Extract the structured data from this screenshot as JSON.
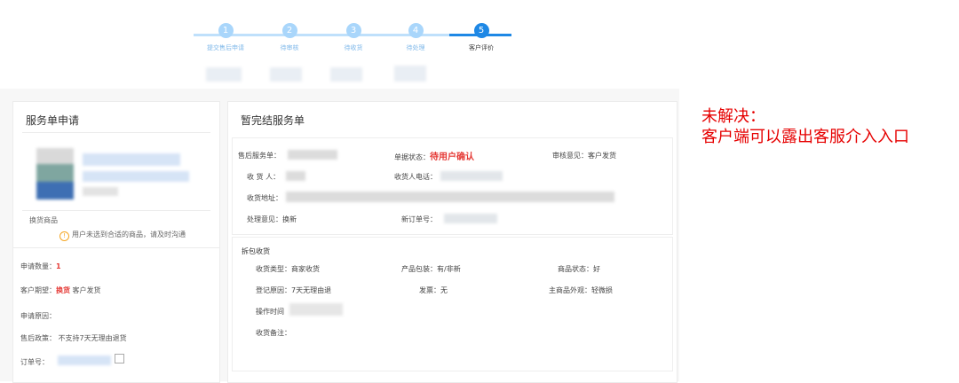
{
  "steps": [
    {
      "num": "1",
      "label": "提交售后申请"
    },
    {
      "num": "2",
      "label": "待审核"
    },
    {
      "num": "3",
      "label": "待收货"
    },
    {
      "num": "4",
      "label": "待处理"
    },
    {
      "num": "5",
      "label": "客户评价"
    }
  ],
  "left": {
    "title": "服务单申请",
    "swap_label": "换货商品",
    "warning": "用户未选到合适的商品，请及时沟通",
    "qty_label": "申请数量：",
    "qty_value": "1",
    "expect_label": "客户期望：",
    "expect_value": "换货",
    "expect_extra": "客户发货",
    "reason_label": "申请原因：",
    "policy_label": "售后政策：",
    "policy_value": "不支持7天无理由退货",
    "order_label": "订单号："
  },
  "right": {
    "title": "暂完结服务单",
    "service_no_label": "售后服务单：",
    "status_label": "单据状态：",
    "status_value": "待用户确认",
    "audit_label": "审核意见：",
    "audit_value": "客户发货",
    "receiver_label": "收 货 人：",
    "phone_label": "收货人电话：",
    "address_label": "收货地址：",
    "handle_label": "处理意见：",
    "handle_value": "换新",
    "new_order_label": "新订单号：",
    "unpack_title": "拆包收货",
    "recv_type_label": "收货类型：",
    "recv_type_value": "商家收货",
    "package_label": "产品包装：",
    "package_value": "有/非新",
    "goods_state_label": "商品状态：",
    "goods_state_value": "好",
    "reg_reason_label": "登记原因：",
    "reg_reason_value": "7天无理由退",
    "invoice_label": "发票：",
    "invoice_value": "无",
    "appearance_label": "主商品外观：",
    "appearance_value": "轻微损",
    "op_time_label": "操作时间",
    "recv_note_label": "收货备注："
  },
  "annotation": {
    "line1": "未解决：",
    "line2": "客户端可以露出客服介入入口"
  },
  "colors": {
    "accent": "#1e88e5",
    "warn": "#e53935",
    "note": "#e60000"
  }
}
